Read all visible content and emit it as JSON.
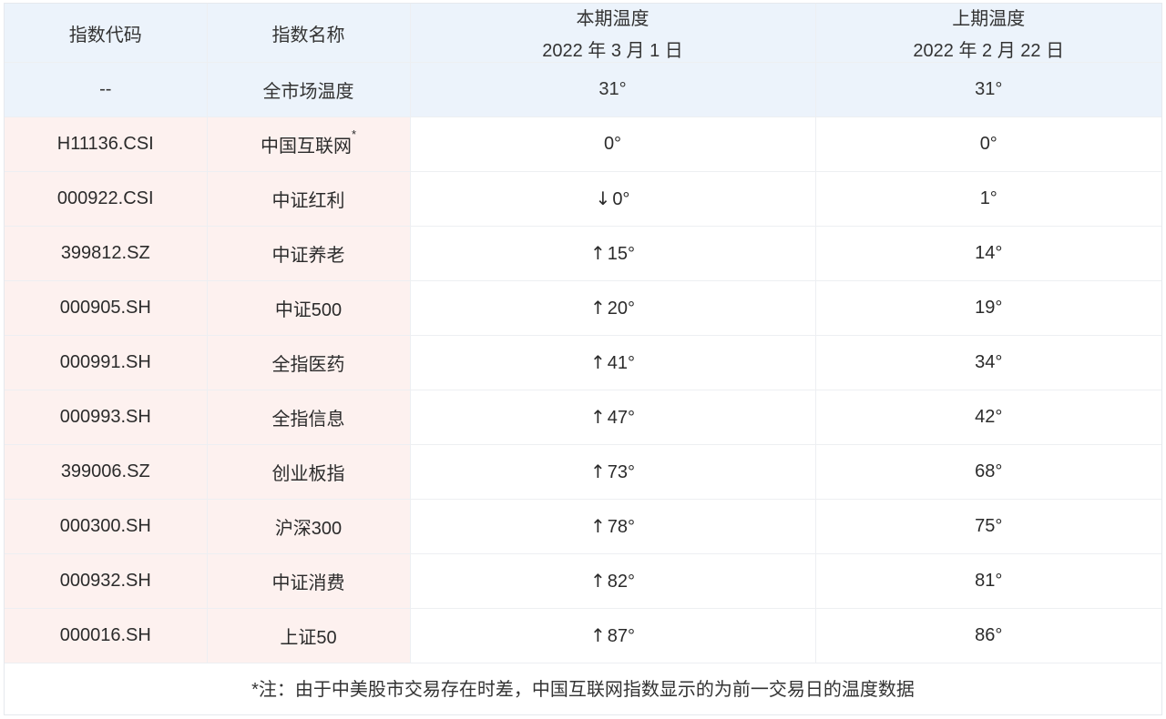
{
  "header": {
    "col_code": "指数代码",
    "col_name": "指数名称",
    "col_current": "本期温度",
    "col_current_date": "2022 年 3 月 1 日",
    "col_previous": "上期温度",
    "col_previous_date": "2022 年 2 月 22 日"
  },
  "market": {
    "code": "--",
    "name": "全市场温度",
    "current": "31°",
    "previous": "31°"
  },
  "rows": [
    {
      "code": "H11136.CSI",
      "name": "中国互联网",
      "star": "*",
      "arrow": "",
      "current": "0°",
      "previous": "0°"
    },
    {
      "code": "000922.CSI",
      "name": "中证红利",
      "arrow": "↓",
      "current": "0°",
      "previous": "1°"
    },
    {
      "code": "399812.SZ",
      "name": "中证养老",
      "arrow": "↑",
      "current": "15°",
      "previous": "14°"
    },
    {
      "code": "000905.SH",
      "name": "中证500",
      "arrow": "↑",
      "current": "20°",
      "previous": "19°"
    },
    {
      "code": "000991.SH",
      "name": "全指医药",
      "arrow": "↑",
      "current": "41°",
      "previous": "34°"
    },
    {
      "code": "000993.SH",
      "name": "全指信息",
      "arrow": "↑",
      "current": "47°",
      "previous": "42°"
    },
    {
      "code": "399006.SZ",
      "name": "创业板指",
      "arrow": "↑",
      "current": "73°",
      "previous": "68°"
    },
    {
      "code": "000300.SH",
      "name": "沪深300",
      "arrow": "↑",
      "current": "78°",
      "previous": "75°"
    },
    {
      "code": "000932.SH",
      "name": "中证消费",
      "arrow": "↑",
      "current": "82°",
      "previous": "81°"
    },
    {
      "code": "000016.SH",
      "name": "上证50",
      "arrow": "↑",
      "current": "87°",
      "previous": "86°"
    }
  ],
  "note": "*注：由于中美股市交易存在时差，中国互联网指数显示的为前一交易日的温度数据"
}
